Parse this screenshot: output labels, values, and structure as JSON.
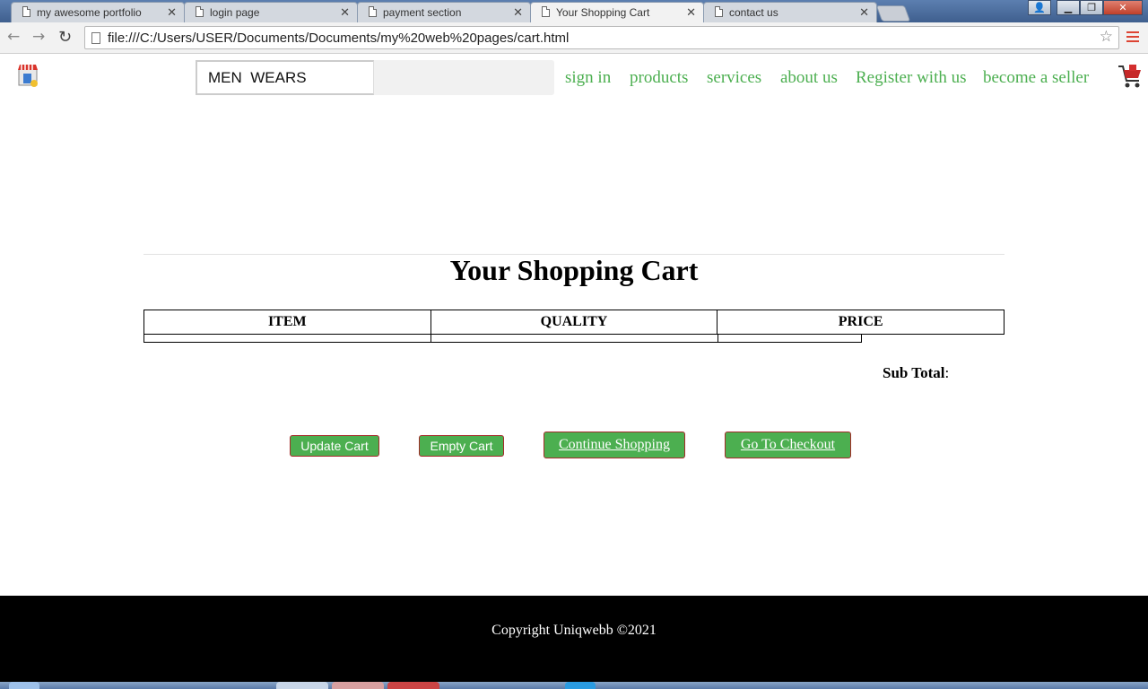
{
  "browser": {
    "tabs": [
      {
        "label": "my awesome portfolio",
        "active": false
      },
      {
        "label": "login page",
        "active": false
      },
      {
        "label": "payment section",
        "active": false
      },
      {
        "label": "Your Shopping Cart",
        "active": true
      },
      {
        "label": "contact us",
        "active": false
      }
    ],
    "url": "file:///C:/Users/USER/Documents/Documents/my%20web%20pages/cart.html"
  },
  "header": {
    "search_value": "MEN  WEARS",
    "nav": [
      "sign in",
      "products",
      "services",
      "about us",
      "Register with us",
      "become a seller"
    ],
    "accent_color": "#4caf50"
  },
  "main": {
    "title": "Your Shopping Cart",
    "table_headers": [
      "ITEM",
      "QUALITY",
      "PRICE"
    ],
    "subtotal_label": "Sub Total",
    "subtotal_colon": ":",
    "buttons": {
      "update": "Update Cart",
      "empty": "Empty Cart",
      "continue": "Continue Shopping",
      "checkout": "Go To Checkout"
    }
  },
  "footer": {
    "copyright": "Copyright Uniqwebb ©2021"
  }
}
